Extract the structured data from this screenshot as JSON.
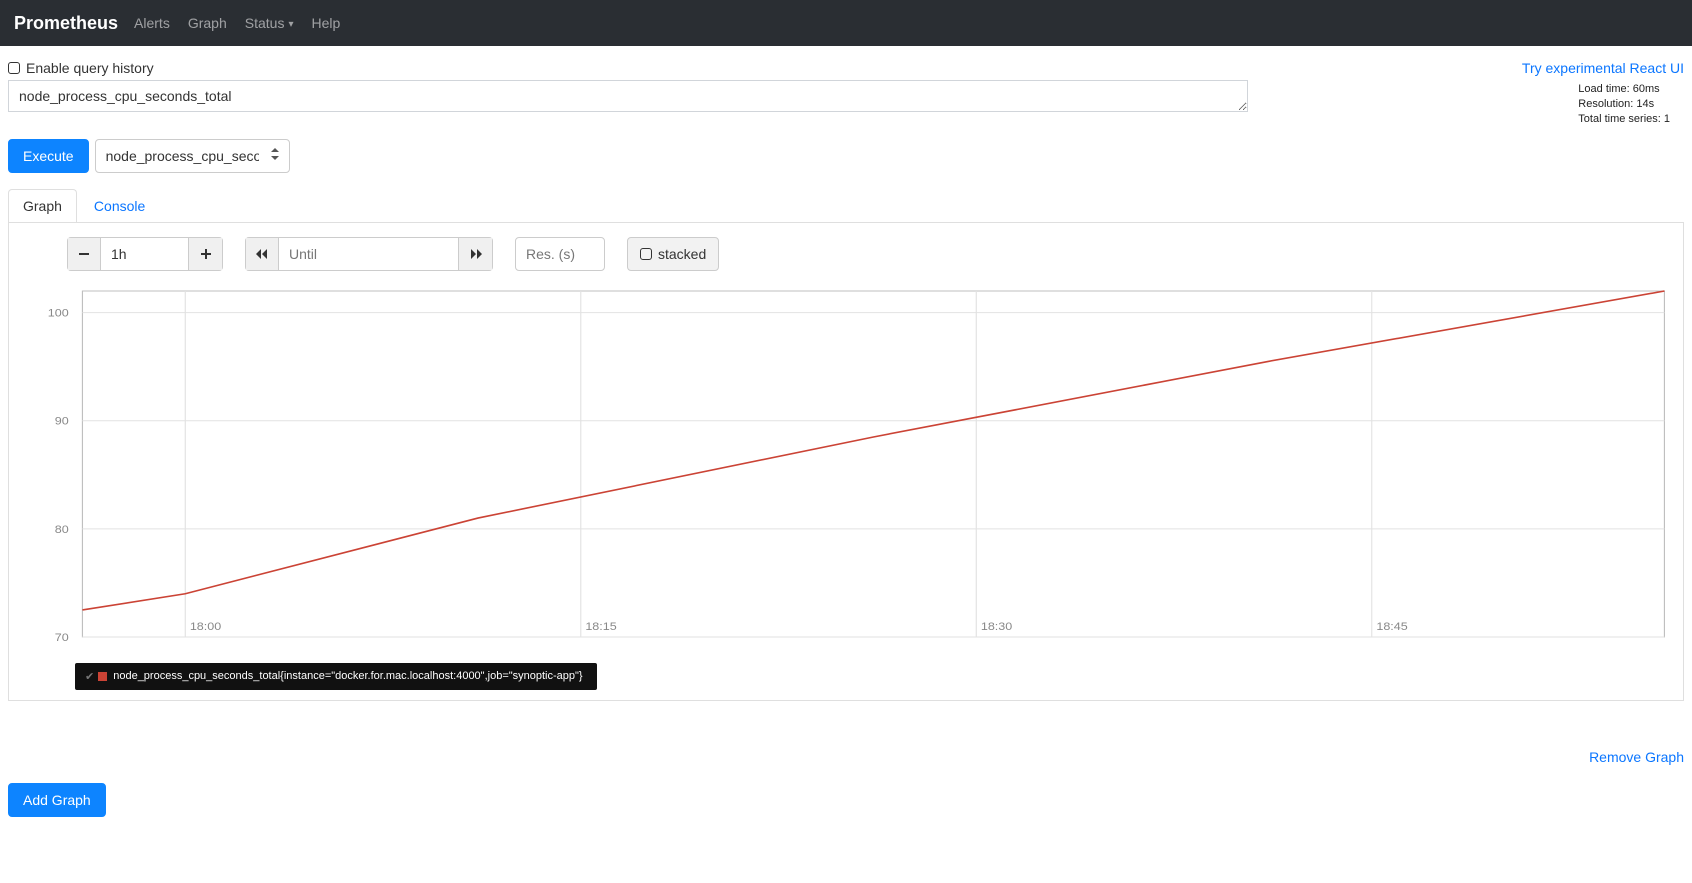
{
  "navbar": {
    "brand": "Prometheus",
    "items": [
      "Alerts",
      "Graph",
      "Status",
      "Help"
    ],
    "dropdown_index": 2
  },
  "top": {
    "enable_history_label": "Enable query history",
    "try_link": "Try experimental React UI"
  },
  "query": {
    "expression": "node_process_cpu_seconds_total"
  },
  "stats": {
    "load": "Load time: 60ms",
    "resolution": "Resolution: 14s",
    "series": "Total time series: 1"
  },
  "actions": {
    "execute": "Execute",
    "metric_select": "node_process_cpu_seconds_total",
    "add_graph": "Add Graph",
    "remove_graph": "Remove Graph"
  },
  "tabs": {
    "graph": "Graph",
    "console": "Console"
  },
  "controls": {
    "range": "1h",
    "until_placeholder": "Until",
    "res_placeholder": "Res. (s)",
    "stacked_label": "stacked"
  },
  "legend": {
    "text": "node_process_cpu_seconds_total{instance=\"docker.for.mac.localhost:4000\",job=\"synoptic-app\"}"
  },
  "chart_data": {
    "type": "line",
    "title": "",
    "xlabel": "",
    "ylabel": "",
    "ylim": [
      70,
      102
    ],
    "x_ticks": [
      "18:00",
      "18:15",
      "18:30",
      "18:45"
    ],
    "y_ticks": [
      70,
      80,
      90,
      100
    ],
    "series": [
      {
        "name": "node_process_cpu_seconds_total{instance=\"docker.for.mac.localhost:4000\",job=\"synoptic-app\"}",
        "color": "#cb4335",
        "x": [
          0,
          6.5,
          25,
          50,
          75,
          100
        ],
        "y": [
          72.5,
          74,
          81,
          88.5,
          95.5,
          102
        ]
      }
    ]
  }
}
